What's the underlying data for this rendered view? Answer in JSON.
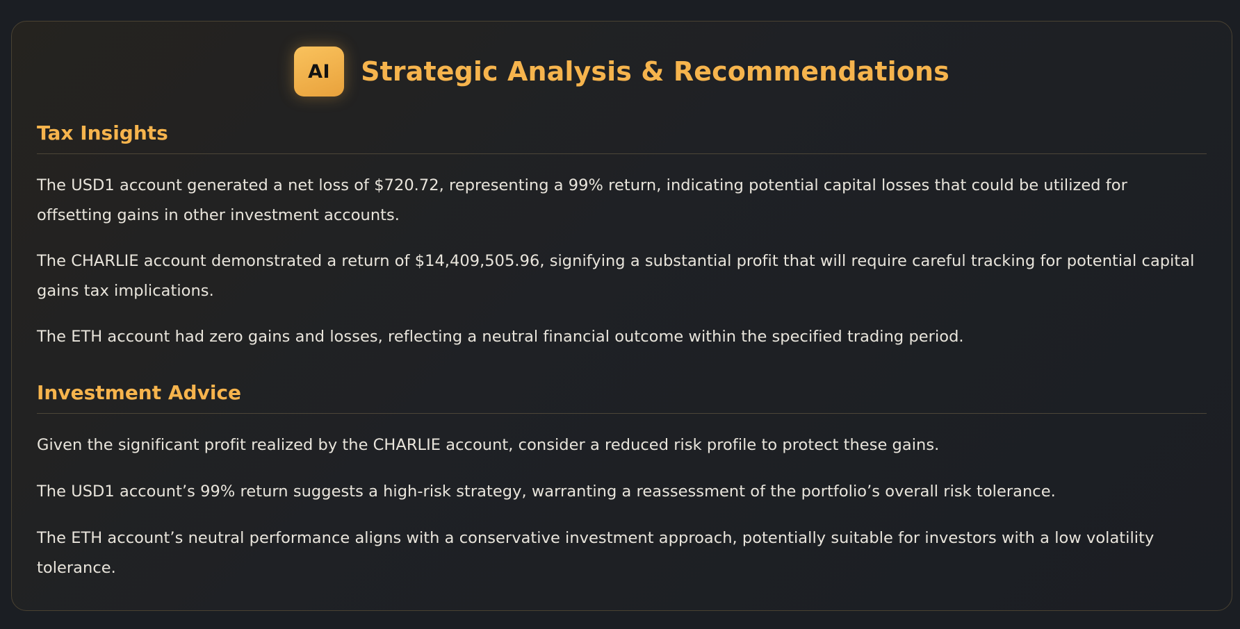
{
  "header": {
    "badge": "AI",
    "title": "Strategic Analysis & Recommendations"
  },
  "tax": {
    "title": "Tax Insights",
    "items": [
      "The USD1 account generated a net loss of $720.72, representing a 99% return, indicating potential capital losses that could be utilized for offsetting gains in other investment accounts.",
      "The CHARLIE account demonstrated a return of $14,409,505.96, signifying a substantial profit that will require careful tracking for potential capital gains tax implications.",
      "The ETH account had zero gains and losses, reflecting a neutral financial outcome within the specified trading period."
    ]
  },
  "advice": {
    "title": "Investment Advice",
    "items": [
      "Given the significant profit realized by the CHARLIE account, consider a reduced risk profile to protect these gains.",
      "The USD1 account’s 99% return suggests a high-risk strategy, warranting a reassessment of the portfolio’s overall risk tolerance.",
      "The ETH account’s neutral performance aligns with a conservative investment approach, potentially suitable for investors with a low volatility tolerance."
    ]
  },
  "colors": {
    "accent": "#f6b44d",
    "background": "#1b1e23",
    "text": "#e9e5dc"
  }
}
